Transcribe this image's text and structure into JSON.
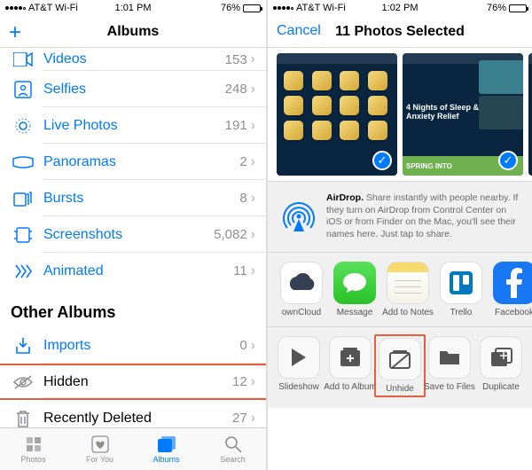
{
  "left": {
    "status": {
      "carrier": "AT&T Wi-Fi",
      "time": "1:01 PM",
      "battery": "76%",
      "batt_pct": 76
    },
    "nav": {
      "title": "Albums"
    },
    "albums": [
      {
        "icon": "videos-icon",
        "name": "Videos",
        "count": "153"
      },
      {
        "icon": "selfies-icon",
        "name": "Selfies",
        "count": "248"
      },
      {
        "icon": "livephotos-icon",
        "name": "Live Photos",
        "count": "191"
      },
      {
        "icon": "panoramas-icon",
        "name": "Panoramas",
        "count": "2"
      },
      {
        "icon": "bursts-icon",
        "name": "Bursts",
        "count": "8"
      },
      {
        "icon": "screenshots-icon",
        "name": "Screenshots",
        "count": "5,082"
      },
      {
        "icon": "animated-icon",
        "name": "Animated",
        "count": "11"
      }
    ],
    "sectionOther": "Other Albums",
    "other": [
      {
        "icon": "imports-icon",
        "name": "Imports",
        "count": "0"
      },
      {
        "icon": "hidden-icon",
        "name": "Hidden",
        "count": "12"
      },
      {
        "icon": "deleted-icon",
        "name": "Recently Deleted",
        "count": "27"
      }
    ],
    "tabs": [
      {
        "name": "Photos"
      },
      {
        "name": "For You"
      },
      {
        "name": "Albums"
      },
      {
        "name": "Search"
      }
    ]
  },
  "right": {
    "status": {
      "carrier": "AT&T Wi-Fi",
      "time": "1:02 PM",
      "battery": "76%",
      "batt_pct": 76
    },
    "nav": {
      "cancel": "Cancel",
      "title": "11 Photos Selected"
    },
    "thumb_b": {
      "line1": "4 Nights of Sleep &",
      "line2": "Anxiety Relief",
      "banner": "SPRING INTO"
    },
    "airdrop": {
      "title": "AirDrop.",
      "text": " Share instantly with people nearby. If they turn on AirDrop from Control Center on iOS or from Finder on the Mac, you'll see their names here. Just tap to share."
    },
    "share": [
      {
        "name": "ownCloud",
        "bg": "#ffffff"
      },
      {
        "name": "Message",
        "bg": "#32d74b"
      },
      {
        "name": "Add to Notes",
        "bg": "#ffffff"
      },
      {
        "name": "Trello",
        "bg": "#ffffff"
      },
      {
        "name": "Facebook",
        "bg": "#1877f2"
      }
    ],
    "actions": [
      {
        "name": "Slideshow"
      },
      {
        "name": "Add to Album"
      },
      {
        "name": "Unhide"
      },
      {
        "name": "Save to Files"
      },
      {
        "name": "Duplicate"
      }
    ]
  }
}
